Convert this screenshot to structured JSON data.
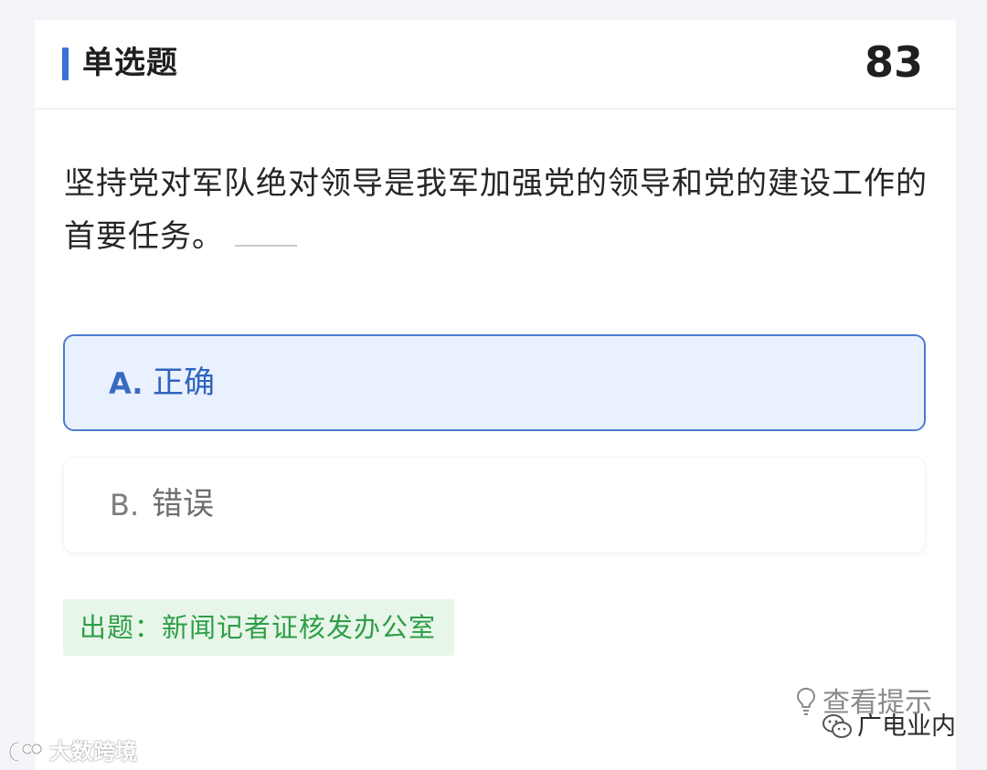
{
  "header": {
    "type_label": "单选题",
    "question_number": "83"
  },
  "question": {
    "text": "坚持党对军队绝对领导是我军加强党的领导和党的建设工作的首要任务。"
  },
  "options": [
    {
      "letter": "A.",
      "text": "正确",
      "selected": true
    },
    {
      "letter": "B.",
      "text": "错误",
      "selected": false
    }
  ],
  "source": {
    "text": "出题：新闻记者证核发办公室"
  },
  "hint": {
    "label": "查看提示",
    "icon": "lightbulb-icon"
  },
  "watermarks": {
    "left_text": "大数跨境",
    "right_text": "广电业内"
  },
  "colors": {
    "accent": "#3a72d6",
    "selected_bg": "#eaf1fe",
    "selected_border": "#4d7bd0",
    "source_bg": "#e8f6ea",
    "source_text": "#2f9e47"
  }
}
